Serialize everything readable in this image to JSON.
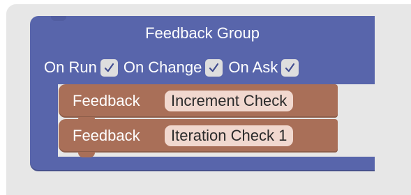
{
  "group": {
    "title": "Feedback Group",
    "options": [
      {
        "label": "On Run",
        "checked": true,
        "mark": "√"
      },
      {
        "label": "On Change",
        "checked": true,
        "mark": "√"
      },
      {
        "label": "On Ask",
        "checked": true,
        "mark": "√"
      }
    ]
  },
  "feedback_blocks": [
    {
      "label": "Feedback",
      "field": "Increment Check"
    },
    {
      "label": "Feedback",
      "field": "Iteration Check 1"
    }
  ],
  "colors": {
    "canvas": "#e7e7e7",
    "group_block": "#5865ab",
    "feedback_block": "#a96f58",
    "feedback_field": "#f1d8cf",
    "checkbox": "#dedede",
    "checkmark": "#3f4b8f"
  },
  "icons": {
    "checkbox": "checkmark-icon"
  }
}
